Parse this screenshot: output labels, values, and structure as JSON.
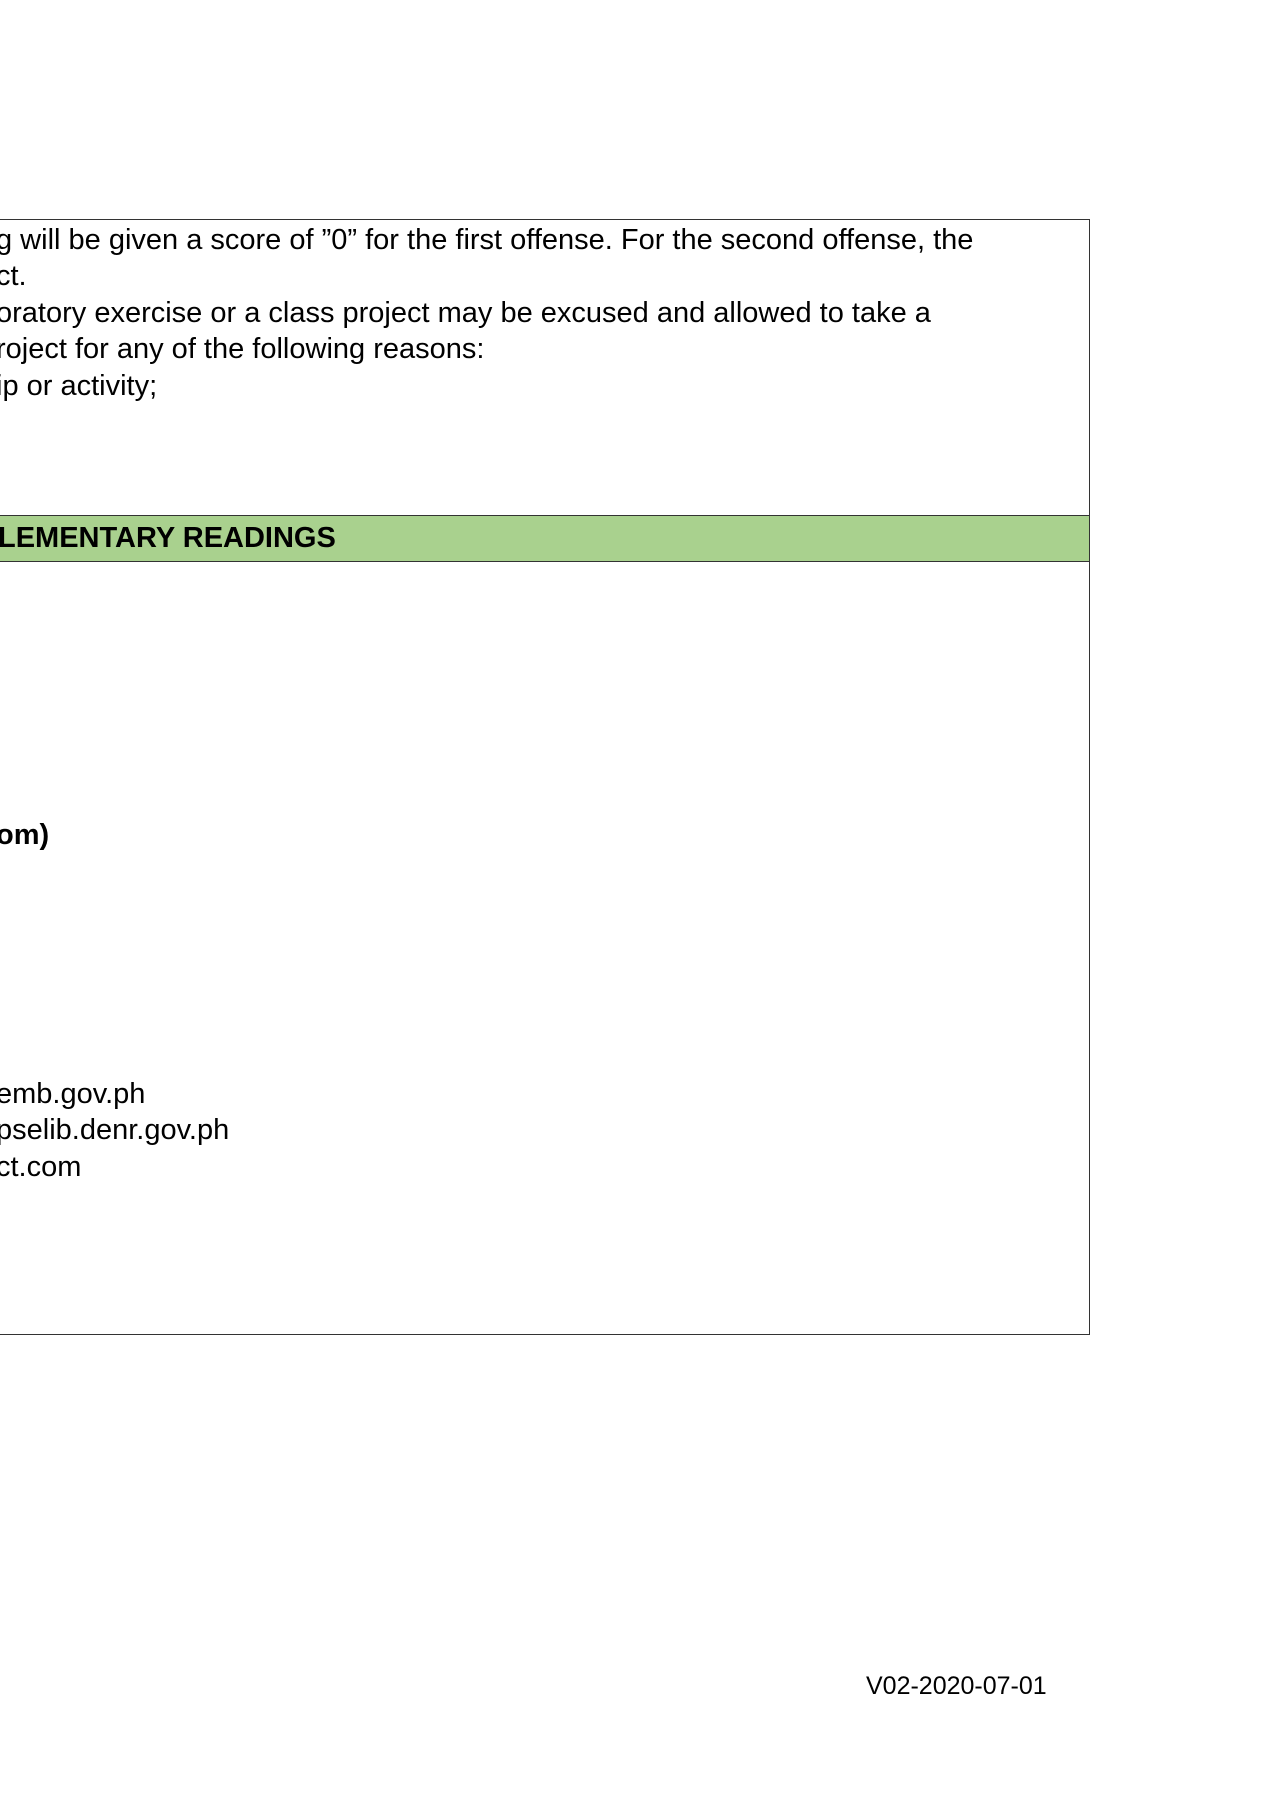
{
  "policy": {
    "lines": [
      "g will be given a score of ”0” for the first offense. For the second offense, the",
      "ct.",
      "oratory exercise or a class project may be excused and allowed to take a",
      "roject for any of the following reasons:",
      "ip or activity;"
    ]
  },
  "readings_header": {
    "title": "LEMENTARY READINGS"
  },
  "readings": {
    "room_label": "om)",
    "links": [
      "emb.gov.ph",
      "pselib.denr.gov.ph",
      "ct.com"
    ]
  },
  "footer": {
    "version": "V02-2020-07-01"
  },
  "colors": {
    "header_background": "#a9d18e",
    "border": "#333333"
  }
}
